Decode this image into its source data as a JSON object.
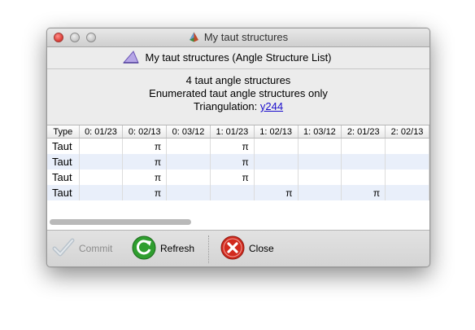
{
  "window": {
    "title": "My taut structures"
  },
  "header": {
    "title": "My taut structures (Angle Structure List)"
  },
  "info": {
    "line1": "4 taut angle structures",
    "line2": "Enumerated taut angle structures only",
    "triangulation_label": "Triangulation:",
    "triangulation_link": "y244"
  },
  "table": {
    "columns": [
      "Type",
      "0: 01/23",
      "0: 02/13",
      "0: 03/12",
      "1: 01/23",
      "1: 02/13",
      "1: 03/12",
      "2: 01/23",
      "2: 02/13"
    ],
    "rows": [
      [
        "Taut",
        "",
        "π",
        "",
        "π",
        "",
        "",
        "",
        ""
      ],
      [
        "Taut",
        "",
        "π",
        "",
        "π",
        "",
        "",
        "",
        ""
      ],
      [
        "Taut",
        "",
        "π",
        "",
        "π",
        "",
        "",
        "",
        ""
      ],
      [
        "Taut",
        "",
        "π",
        "",
        "",
        "π",
        "",
        "π",
        ""
      ]
    ]
  },
  "toolbar": {
    "commit_label": "Commit",
    "refresh_label": "Refresh",
    "close_label": "Close"
  },
  "icons": {
    "title": "polyhedron-icon",
    "header": "angle-icon",
    "commit": "checkmark-icon",
    "refresh": "refresh-icon",
    "close": "close-icon"
  },
  "colors": {
    "alt_row": "#e9effa",
    "link": "#1a0dcc",
    "refresh_green": "#2f9e2f",
    "close_red": "#d22a1e"
  }
}
